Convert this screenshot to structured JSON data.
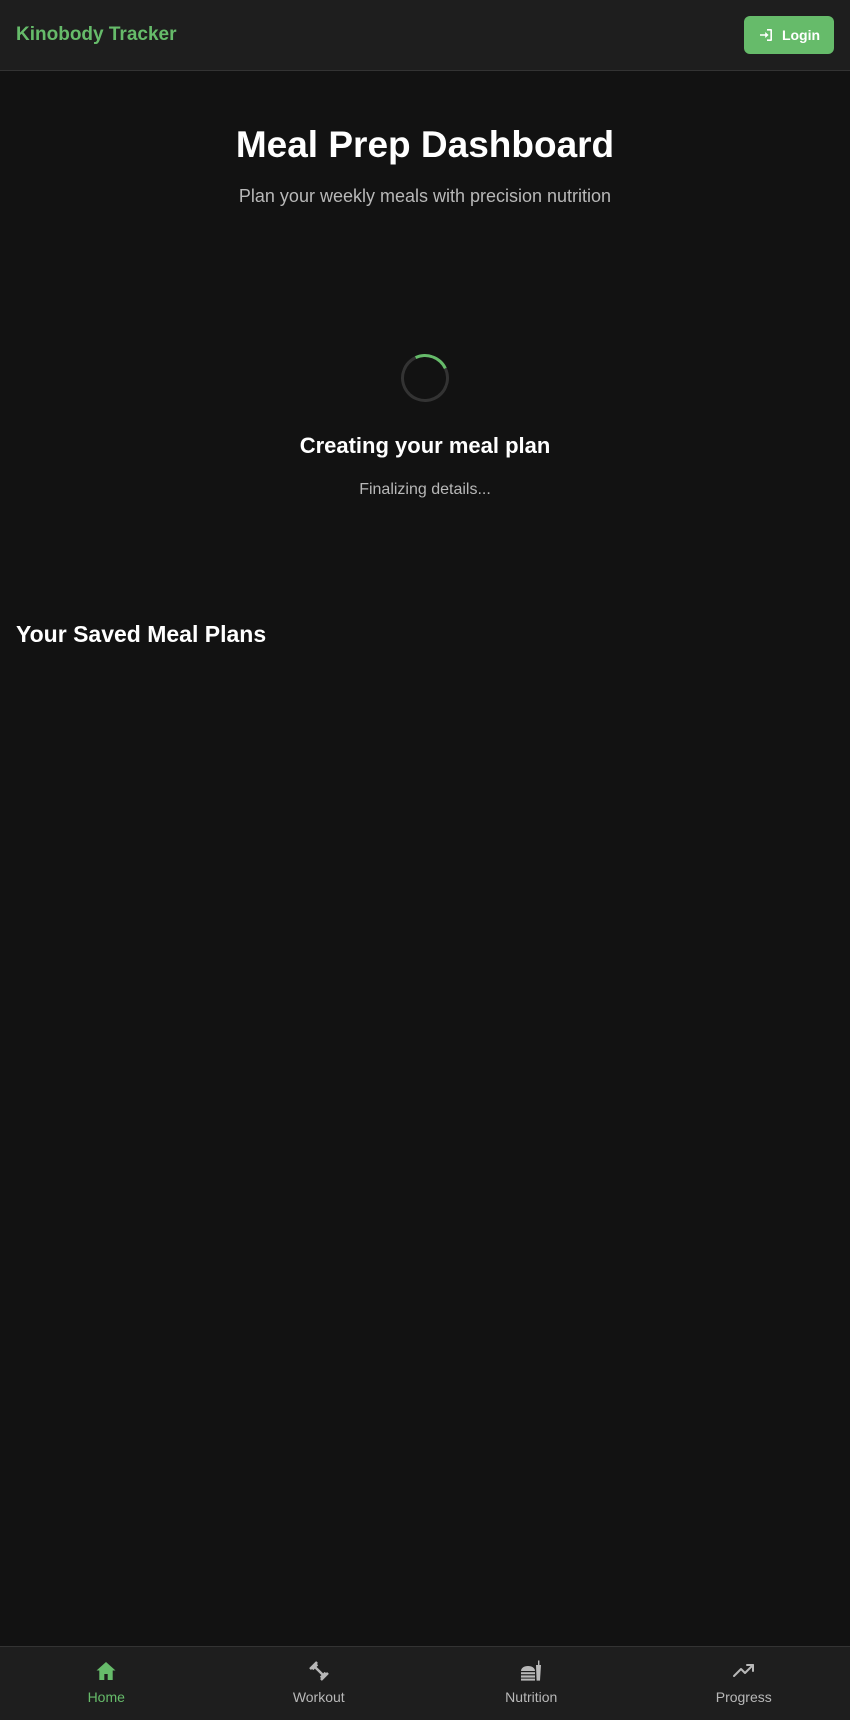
{
  "header": {
    "brand": "Kinobody Tracker",
    "login_label": "Login",
    "login_icon": "sign-in-icon"
  },
  "main": {
    "title": "Meal Prep Dashboard",
    "subtitle": "Plan your weekly meals with precision nutrition"
  },
  "loading": {
    "title": "Creating your meal plan",
    "status": "Finalizing details..."
  },
  "saved_plans": {
    "title": "Your Saved Meal Plans"
  },
  "bottom_nav": {
    "items": [
      {
        "label": "Home",
        "icon": "home-icon",
        "active": true
      },
      {
        "label": "Workout",
        "icon": "dumbbell-icon",
        "active": false
      },
      {
        "label": "Nutrition",
        "icon": "food-icon",
        "active": false
      },
      {
        "label": "Progress",
        "icon": "trend-up-icon",
        "active": false
      }
    ]
  },
  "colors": {
    "accent": "#66bb6a",
    "background": "#121212",
    "surface": "#1e1e1e",
    "text_secondary": "#b8b8b8"
  }
}
